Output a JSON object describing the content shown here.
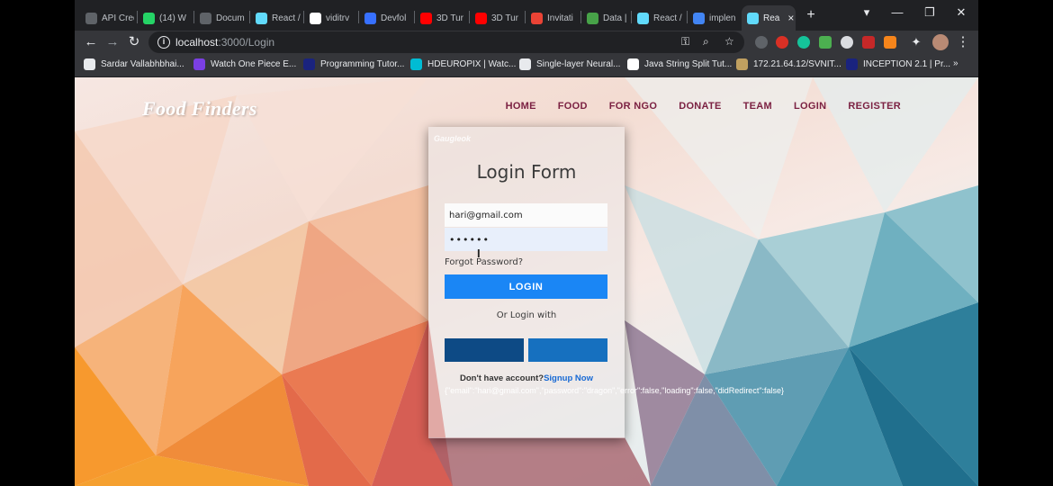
{
  "browser": {
    "tabs": [
      {
        "label": "API Creden",
        "icon": "api-icon",
        "color": "#5f6368"
      },
      {
        "label": "(14) W",
        "icon": "whatsapp-icon",
        "color": "#25d366"
      },
      {
        "label": "Docum",
        "icon": "globe-icon",
        "color": "#5f6368"
      },
      {
        "label": "React /",
        "icon": "react-icon",
        "color": "#61dafb"
      },
      {
        "label": "viditrv",
        "icon": "github-icon",
        "color": "#ffffff"
      },
      {
        "label": "Devfol",
        "icon": "devfolio-icon",
        "color": "#3770ff"
      },
      {
        "label": "3D Tur",
        "icon": "youtube-icon",
        "color": "#ff0000"
      },
      {
        "label": "3D Tur",
        "icon": "youtube-icon",
        "color": "#ff0000"
      },
      {
        "label": "Invitati",
        "icon": "gmail-icon",
        "color": "#ea4335"
      },
      {
        "label": "Data | c",
        "icon": "mongodb-icon",
        "color": "#47a248"
      },
      {
        "label": "React /",
        "icon": "react-icon",
        "color": "#61dafb"
      },
      {
        "label": "implen",
        "icon": "google-icon",
        "color": "#4285f4"
      },
      {
        "label": "Rea",
        "icon": "react-icon",
        "color": "#61dafb"
      }
    ],
    "new_tab": "+",
    "url_host": "localhost",
    "url_path": ":3000/Login",
    "bookmarks": [
      {
        "label": "Sardar Vallabhbhai...",
        "icon": "globe-icon"
      },
      {
        "label": "Watch One Piece E...",
        "icon": "play-icon"
      },
      {
        "label": "Programming Tutor...",
        "icon": "bookmark-icon"
      },
      {
        "label": "HDEUROPIX | Watc...",
        "icon": "hd-icon"
      },
      {
        "label": "Single-layer Neural...",
        "icon": "image-icon"
      },
      {
        "label": "Java String Split Tut...",
        "icon": "jn-icon"
      },
      {
        "label": "172.21.64.12/SVNIT...",
        "icon": "page-icon"
      },
      {
        "label": "INCEPTION 2.1 | Pr...",
        "icon": "bookmark-icon"
      }
    ],
    "more_bookmarks": "»"
  },
  "site": {
    "logo": "Food Finders",
    "nav": [
      "HOME",
      "FOOD",
      "FOR NGO",
      "DONATE",
      "TEAM",
      "LOGIN",
      "REGISTER"
    ]
  },
  "form": {
    "badge": "Gaugleok",
    "title": "Login Form",
    "email_value": "hari@gmail.com",
    "password_value": "••••••",
    "forgot": "Forgot Password?",
    "login_button": "LOGIN",
    "or_text": "Or Login with",
    "no_account": "Don't have account?",
    "signup": "Signup Now",
    "debug_state": "{\"email\":\"hari@gmail.com\",\"password\":\"dragon\",\"error\":false,\"loading\":false,\"didRedirect\":false}"
  },
  "colors": {
    "nav_text": "#7b2142",
    "login_button": "#1a86f5",
    "social_left": "#0d4a85",
    "social_right": "#1670bf"
  }
}
